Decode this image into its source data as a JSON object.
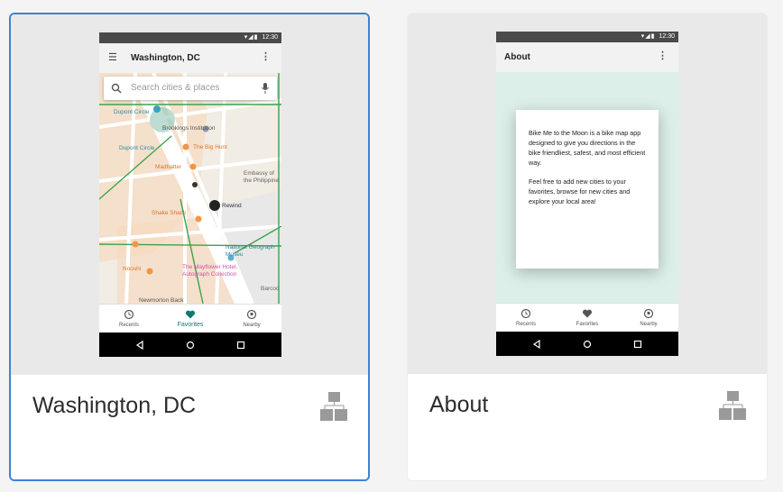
{
  "cards": [
    {
      "title": "Washington, DC",
      "selected": true,
      "phone": {
        "status_time": "12:30",
        "app_title": "Washington, DC",
        "search_placeholder": "Search cities & places",
        "map_labels": {
          "dupont_circle": "Dupont Circle",
          "brookings": "Brookings Institution",
          "dupont_circle_2": "Dupont Circle",
          "big_hunt": "The Big Hunt",
          "madhatter": "Madhatter",
          "embassy": "Embassy of\nthe Philippine",
          "rewind": "Rewind",
          "shake_shack": "Shake Shack",
          "natgeo": "National Geograph\nMuseu",
          "nooshi": "Nooshi",
          "mayflower": "The Mayflower Hotel,\nAutograph Collection",
          "barcode": "Barcod",
          "newmorton": "Newmorton Back"
        },
        "nav": [
          "Recents",
          "Favorites",
          "Nearby"
        ]
      }
    },
    {
      "title": "About",
      "selected": false,
      "phone": {
        "status_time": "12:30",
        "app_title": "About",
        "paragraph1": "Bike Me to the Moon is a bike map app designed to give you directions in the bike friendliest, safest, and most efficient way.",
        "paragraph2": "Feel free to add new cities to your favorites, browse for new cities and explore your local area!",
        "nav": [
          "Recents",
          "Favorites",
          "Nearby"
        ]
      }
    }
  ],
  "colors": {
    "selected_border": "#3b83d6",
    "accent_teal": "#0e7a6c",
    "about_bg": "#dcefe8"
  },
  "icons": {
    "card_icon": "flow-diagram-icon"
  }
}
